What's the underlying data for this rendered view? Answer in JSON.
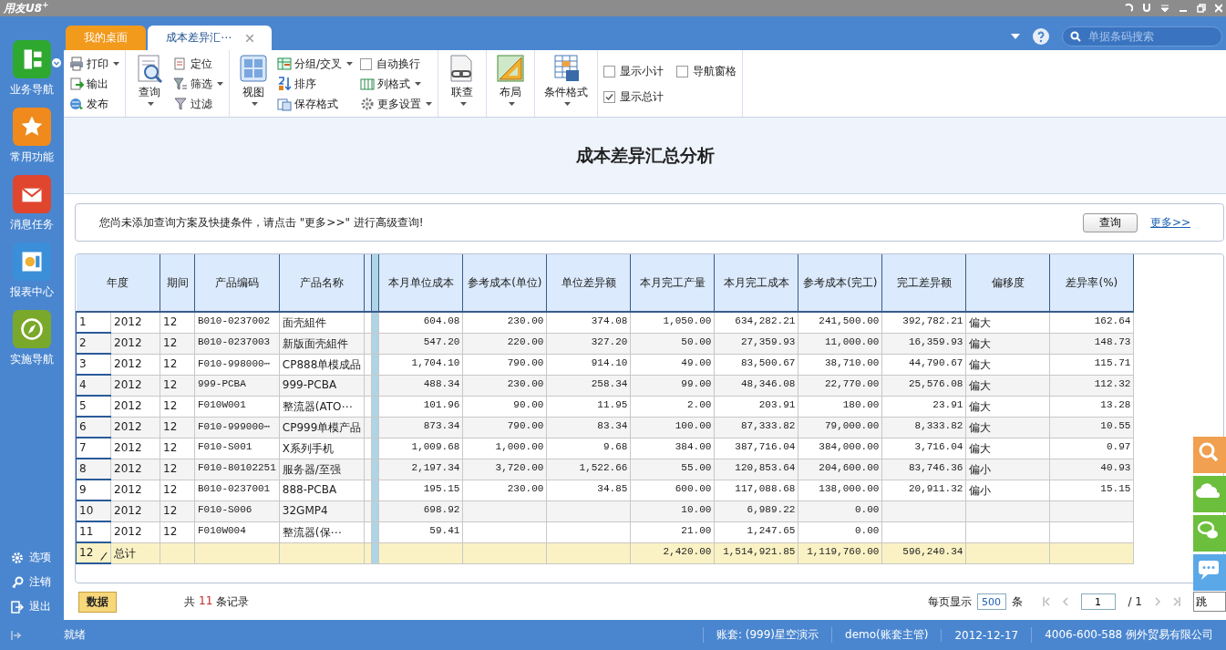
{
  "app": {
    "logo": "用友U8$^{+}$"
  },
  "sidebar": {
    "items": [
      {
        "label": "业务导航",
        "kind": "nav",
        "color": "#2fa82f",
        "dropdown": true
      },
      {
        "label": "常用功能",
        "kind": "star",
        "color": "#f08a1c",
        "dropdown": false
      },
      {
        "label": "消息任务",
        "kind": "mail",
        "color": "#e0452e",
        "dropdown": false
      },
      {
        "label": "报表中心",
        "kind": "report",
        "color": "#3a8fd8",
        "dropdown": false
      },
      {
        "label": "实施导航",
        "kind": "compass",
        "color": "#7aa82a",
        "dropdown": false
      }
    ],
    "bottom": [
      {
        "label": "选项",
        "kind": "gear"
      },
      {
        "label": "注销",
        "kind": "key"
      },
      {
        "label": "退出",
        "kind": "exit"
      }
    ]
  },
  "tabs": [
    {
      "label": "我的桌面",
      "selected": false,
      "closable": false
    },
    {
      "label": "成本差异汇⋯",
      "selected": true,
      "closable": true
    }
  ],
  "search": {
    "placeholder": "单据条码搜索"
  },
  "toolbar": {
    "groups": [
      {
        "items": [
          {
            "kind": "small",
            "label": "打印",
            "dropdown": true
          },
          {
            "kind": "small",
            "label": "输出",
            "dropdown": false
          },
          {
            "kind": "small",
            "label": "发布",
            "dropdown": false
          }
        ]
      },
      {
        "items": [
          {
            "kind": "large",
            "label": "查询",
            "dropdown": true
          },
          {
            "kind": "small",
            "label": "定位",
            "dropdown": false
          },
          {
            "kind": "small",
            "label": "筛选",
            "dropdown": true
          },
          {
            "kind": "small",
            "label": "过滤",
            "dropdown": false
          }
        ]
      },
      {
        "items": [
          {
            "kind": "large",
            "label": "视图",
            "dropdown": true
          },
          {
            "kind": "small",
            "label": "分组/交叉",
            "dropdown": true
          },
          {
            "kind": "small",
            "label": "排序",
            "dropdown": false
          },
          {
            "kind": "small",
            "label": "保存格式",
            "dropdown": false
          },
          {
            "kind": "checkbox",
            "label": "自动换行",
            "checked": false
          },
          {
            "kind": "small",
            "label": "列格式",
            "dropdown": true
          },
          {
            "kind": "small",
            "label": "更多设置",
            "dropdown": true
          }
        ]
      },
      {
        "items": [
          {
            "kind": "large",
            "label": "联查",
            "dropdown": true
          }
        ]
      },
      {
        "items": [
          {
            "kind": "large",
            "label": "布局",
            "dropdown": true
          }
        ]
      },
      {
        "items": [
          {
            "kind": "large",
            "label": "条件格式",
            "dropdown": true
          }
        ]
      },
      {
        "items": [
          {
            "kind": "checkbox",
            "label": "显示小计",
            "checked": false
          },
          {
            "kind": "checkbox",
            "label": "导航窗格",
            "checked": false
          },
          {
            "kind": "checkbox",
            "label": "显示总计",
            "checked": true
          }
        ]
      }
    ]
  },
  "report": {
    "title": "成本差异汇总分析"
  },
  "query": {
    "hint": "您尚未添加查询方案及快捷条件，请点击 \"更多>>\" 进行高级查询!",
    "button": "查询",
    "link": "更多>>"
  },
  "table": {
    "columns": [
      "年度",
      "期间",
      "产品编码",
      "产品名称",
      "",
      "",
      "本月单位成本",
      "参考成本(单位)",
      "单位差异额",
      "本月完工产量",
      "本月完工成本",
      "参考成本(完工)",
      "完工差异额",
      "偏移度",
      "差异率(%)"
    ],
    "rows": [
      {
        "kind": "data",
        "index": "1",
        "cells": [
          "2012",
          "12",
          "B010-0237002",
          "面壳組件",
          "",
          "",
          "604.08",
          "230.00",
          "374.08",
          "1,050.00",
          "634,282.21",
          "241,500.00",
          "392,782.21",
          "偏大",
          "162.64"
        ]
      },
      {
        "kind": "data",
        "index": "2",
        "cells": [
          "2012",
          "12",
          "B010-0237003",
          "新版面壳組件",
          "",
          "",
          "547.20",
          "220.00",
          "327.20",
          "50.00",
          "27,359.93",
          "11,000.00",
          "16,359.93",
          "偏大",
          "148.73"
        ]
      },
      {
        "kind": "data",
        "index": "3",
        "cells": [
          "2012",
          "12",
          "F010-998000⋯",
          "CP888单模成品",
          "",
          "",
          "1,704.10",
          "790.00",
          "914.10",
          "49.00",
          "83,500.67",
          "38,710.00",
          "44,790.67",
          "偏大",
          "115.71"
        ]
      },
      {
        "kind": "data",
        "index": "4",
        "cells": [
          "2012",
          "12",
          "999-PCBA",
          "999-PCBA",
          "",
          "",
          "488.34",
          "230.00",
          "258.34",
          "99.00",
          "48,346.08",
          "22,770.00",
          "25,576.08",
          "偏大",
          "112.32"
        ]
      },
      {
        "kind": "data",
        "index": "5",
        "cells": [
          "2012",
          "12",
          "F010W001",
          "整流器(ATO⋯",
          "",
          "",
          "101.96",
          "90.00",
          "11.95",
          "2.00",
          "203.91",
          "180.00",
          "23.91",
          "偏大",
          "13.28"
        ]
      },
      {
        "kind": "data",
        "index": "6",
        "cells": [
          "2012",
          "12",
          "F010-999000⋯",
          "CP999单模产品",
          "",
          "",
          "873.34",
          "790.00",
          "83.34",
          "100.00",
          "87,333.82",
          "79,000.00",
          "8,333.82",
          "偏大",
          "10.55"
        ]
      },
      {
        "kind": "data",
        "index": "7",
        "cells": [
          "2012",
          "12",
          "F010-S001",
          "X系列手机",
          "",
          "",
          "1,009.68",
          "1,000.00",
          "9.68",
          "384.00",
          "387,716.04",
          "384,000.00",
          "3,716.04",
          "偏大",
          "0.97"
        ]
      },
      {
        "kind": "data",
        "index": "8",
        "cells": [
          "2012",
          "12",
          "F010-80102251",
          "服务器/至强",
          "",
          "",
          "2,197.34",
          "3,720.00",
          "1,522.66",
          "55.00",
          "120,853.64",
          "204,600.00",
          "83,746.36",
          "偏小",
          "40.93"
        ]
      },
      {
        "kind": "data",
        "index": "9",
        "cells": [
          "2012",
          "12",
          "B010-0237001",
          "888-PCBA",
          "",
          "",
          "195.15",
          "230.00",
          "34.85",
          "600.00",
          "117,088.68",
          "138,000.00",
          "20,911.32",
          "偏小",
          "15.15"
        ]
      },
      {
        "kind": "data",
        "index": "10",
        "cells": [
          "2012",
          "12",
          "F010-S006",
          "32GMP4",
          "",
          "",
          "698.92",
          "",
          "",
          "10.00",
          "6,989.22",
          "0.00",
          "",
          "",
          ""
        ]
      },
      {
        "kind": "data",
        "index": "11",
        "cells": [
          "2012",
          "12",
          "F010W004",
          "整流器(保⋯",
          "",
          "",
          "59.41",
          "",
          "",
          "21.00",
          "1,247.65",
          "0.00",
          "",
          "",
          ""
        ]
      },
      {
        "kind": "total",
        "index": "12",
        "cells": [
          "总计",
          "",
          "",
          "",
          "",
          "",
          "",
          "",
          "",
          "2,420.00",
          "1,514,921.85",
          "1,119,760.00",
          "596,240.34",
          "",
          ""
        ]
      }
    ]
  },
  "footer": {
    "tab": "数据",
    "count_prefix": "共",
    "count": "11",
    "count_suffix": "条记录",
    "per_page_label": "每页显示",
    "per_page": "500",
    "per_page_unit": "条",
    "page": "1",
    "page_total": "/ 1",
    "jump": "跳"
  },
  "status_bar": {
    "state": "就绪",
    "account": "账套: (999)星空演示",
    "user": "demo(账套主管)",
    "date": "2012-12-17",
    "company": "4006-600-588 例外贸易有限公司"
  },
  "side_tools": [
    {
      "kind": "search",
      "color": "#f0a050"
    },
    {
      "kind": "cloud",
      "color": "#6cbf3c"
    },
    {
      "kind": "chat",
      "color": "#6cbf3c"
    },
    {
      "kind": "message",
      "color": "#5aa8e8"
    }
  ]
}
